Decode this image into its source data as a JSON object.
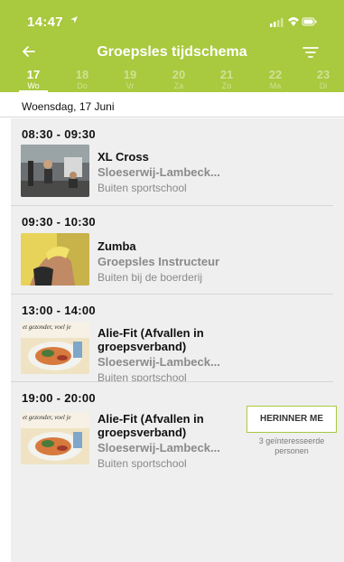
{
  "status_bar": {
    "time": "14:47",
    "location_arrow": "location-arrow-icon"
  },
  "header": {
    "title": "Groepsles tijdschema",
    "back_icon": "arrow-left-icon",
    "filter_icon": "filter-icon",
    "color": "#a9c93e"
  },
  "days": [
    {
      "num": "17",
      "name": "Wo",
      "active": true
    },
    {
      "num": "18",
      "name": "Do",
      "active": false
    },
    {
      "num": "19",
      "name": "Vr",
      "active": false
    },
    {
      "num": "20",
      "name": "Za",
      "active": false
    },
    {
      "num": "21",
      "name": "Zo",
      "active": false
    },
    {
      "num": "22",
      "name": "Ma",
      "active": false
    },
    {
      "num": "23",
      "name": "Di",
      "active": false
    }
  ],
  "date_label": "Woensdag, 17 Juni",
  "sessions": [
    {
      "time": "08:30 - 09:30",
      "name": "XL Cross",
      "trainer": "Sloeserwij-Lambeck...",
      "location": "Buiten sportschool",
      "thumb": "gym"
    },
    {
      "time": "09:30 - 10:30",
      "name": "Zumba",
      "trainer": "Groepsles Instructeur",
      "location": "Buiten bij de boerderij",
      "thumb": "zumba"
    },
    {
      "time": "13:00 - 14:00",
      "name": "Alie-Fit (Afvallen in groepsverband)",
      "trainer": "Sloeserwij-Lambeck...",
      "location": "Buiten sportschool",
      "thumb": "food",
      "thumb_text": "et gezonder, voel je"
    },
    {
      "time": "19:00 - 20:00",
      "name": "Alie-Fit (Afvallen in groepsverband)",
      "trainer": "Sloeserwij-Lambeck...",
      "location": "Buiten sportschool",
      "thumb": "food",
      "thumb_text": "et gezonder, voel je"
    }
  ],
  "remind_button": "HERINNER ME",
  "interested_text": "3 geïnteresseerde personen"
}
